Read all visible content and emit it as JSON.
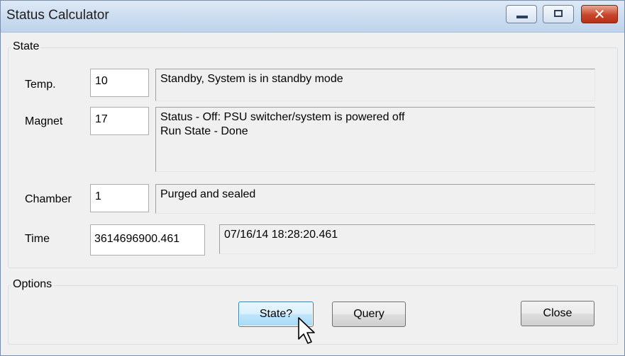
{
  "window": {
    "title": "Status Calculator"
  },
  "state_group": {
    "label": "State",
    "rows": [
      {
        "label": "Temp.",
        "value": "10",
        "lines": [
          "Standby, System is in standby mode"
        ]
      },
      {
        "label": "Magnet",
        "value": "17",
        "lines": [
          "Status - Off: PSU switcher/system is powered off",
          "Run State - Done"
        ]
      },
      {
        "label": "Chamber",
        "value": "1",
        "lines": [
          "Purged and sealed"
        ]
      },
      {
        "label": "Time",
        "value": "3614696900.461",
        "lines": [
          "07/16/14 18:28:20.461"
        ]
      }
    ]
  },
  "options_group": {
    "label": "Options"
  },
  "buttons": {
    "state": "State?",
    "query": "Query",
    "close": "Close"
  },
  "icons": {
    "minimize": "minimize-icon",
    "maximize": "maximize-icon",
    "close": "close-icon",
    "cursor": "mouse-pointer-icon"
  },
  "colors": {
    "close_button": "#c8452b",
    "focused_button": "#bee6fd"
  }
}
